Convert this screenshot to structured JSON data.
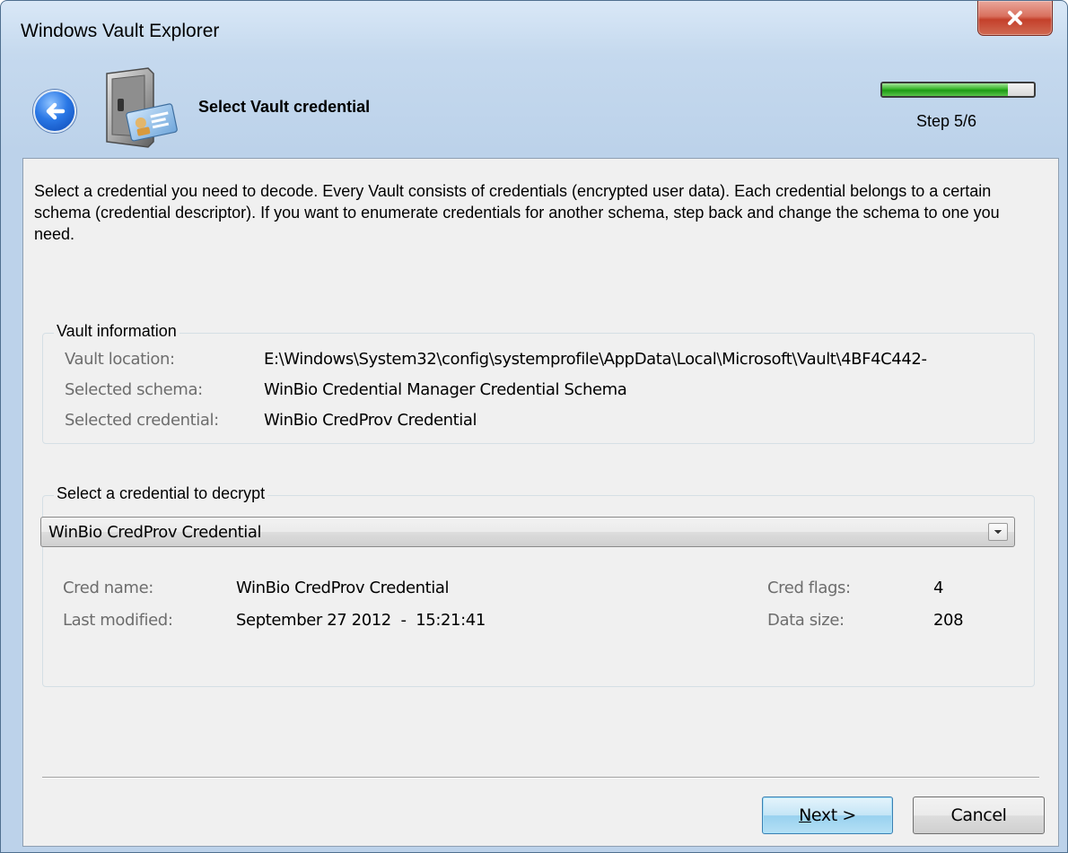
{
  "window": {
    "title": "Windows Vault Explorer"
  },
  "header": {
    "title": "Select Vault credential",
    "step_label": "Step 5/6",
    "progress_fraction": 0.83
  },
  "intro_text": "Select a credential you need to decode. Every Vault consists of credentials (encrypted user data). Each credential belongs to a certain schema (credential descriptor). If you want to enumerate credentials for another schema, step back and change the schema to one you need.",
  "vault_info": {
    "legend": "Vault information",
    "location_label": "Vault location:",
    "location_value": "E:\\Windows\\System32\\config\\systemprofile\\AppData\\Local\\Microsoft\\Vault\\4BF4C442-",
    "schema_label": "Selected schema:",
    "schema_value": "WinBio Credential Manager Credential Schema",
    "credential_label": "Selected credential:",
    "credential_value": "WinBio CredProv Credential"
  },
  "select_group": {
    "legend": "Select a credential to decrypt",
    "selected_option": "WinBio CredProv Credential",
    "cred_name_label": "Cred name:",
    "cred_name_value": "WinBio CredProv Credential",
    "last_modified_label": "Last modified:",
    "last_modified_value": "September 27 2012  -  15:21:41",
    "cred_flags_label": "Cred flags:",
    "cred_flags_value": "4",
    "data_size_label": "Data size:",
    "data_size_value": "208"
  },
  "buttons": {
    "next_hotkey": "N",
    "next_rest": "ext >",
    "cancel": "Cancel"
  }
}
